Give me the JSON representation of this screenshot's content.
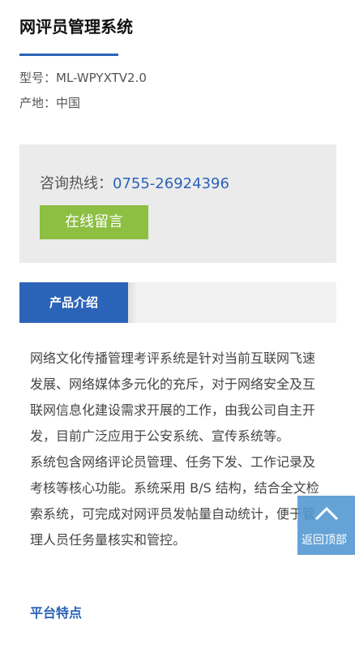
{
  "product": {
    "title": "网评员管理系统",
    "model_label": "型号：",
    "model_value": "ML-WPYXTV2.0",
    "origin_label": "产地：",
    "origin_value": "中国"
  },
  "contact": {
    "hotline_label": "咨询热线：",
    "hotline_number": "0755-26924396",
    "online_message_button": "在线留言"
  },
  "tabs": {
    "active_label": "产品介绍"
  },
  "intro": {
    "paragraph_1": "网络文化传播管理考评系统是针对当前互联网飞速发展、网络媒体多元化的充斥，对于网络安全及互联网信息化建设需求开展的工作，由我公司自主开发，目前广泛应用于公安系统、宣传系统等。",
    "paragraph_2": "系统包含网络评论员管理、任务下发、工作记录及考核等核心功能。系统采用 B/S 结构，结合全文检索系统，可完成对网评员发帖量自动统计，便于管理人员任务量核实和管控。",
    "features_heading": "平台特点"
  },
  "floating": {
    "back_to_top_label": "返回顶部",
    "icon": "chevron-up-icon"
  },
  "colors": {
    "accent_blue": "#2b63b8",
    "button_green": "#8cbf42",
    "panel_gray": "#ebebeb",
    "back_to_top_bg": "#5096d2"
  }
}
